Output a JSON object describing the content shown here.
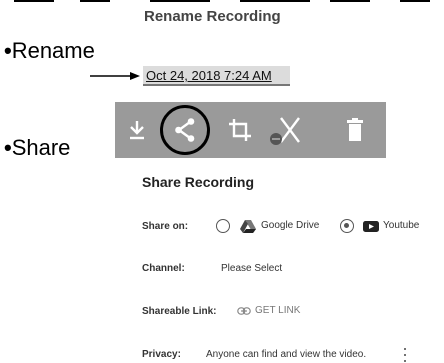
{
  "rename_dialog": {
    "title": "Rename Recording",
    "date_value": "Oct 24, 2018 7:24 AM"
  },
  "annotations": {
    "rename_label": "Rename",
    "share_label": "Share",
    "bullet": "•"
  },
  "toolbar": {
    "icons": [
      "download-icon",
      "share-icon",
      "crop-icon",
      "scissors-icon",
      "delete-icon"
    ]
  },
  "share_panel": {
    "title": "Share Recording",
    "share_on_label": "Share on:",
    "options": [
      {
        "label": "Google Drive",
        "icon": "google-drive-icon",
        "selected": false
      },
      {
        "label": "Youtube",
        "icon": "youtube-icon",
        "selected": true
      }
    ],
    "channel_label": "Channel:",
    "channel_value": "Please Select",
    "shareable_link_label": "Shareable Link:",
    "get_link_label": "GET LINK",
    "privacy_label": "Privacy:",
    "privacy_value": "Anyone can find and view the video."
  },
  "colors": {
    "toolbar_bg": "#9a9a9a",
    "icon_white": "#ffffff"
  }
}
